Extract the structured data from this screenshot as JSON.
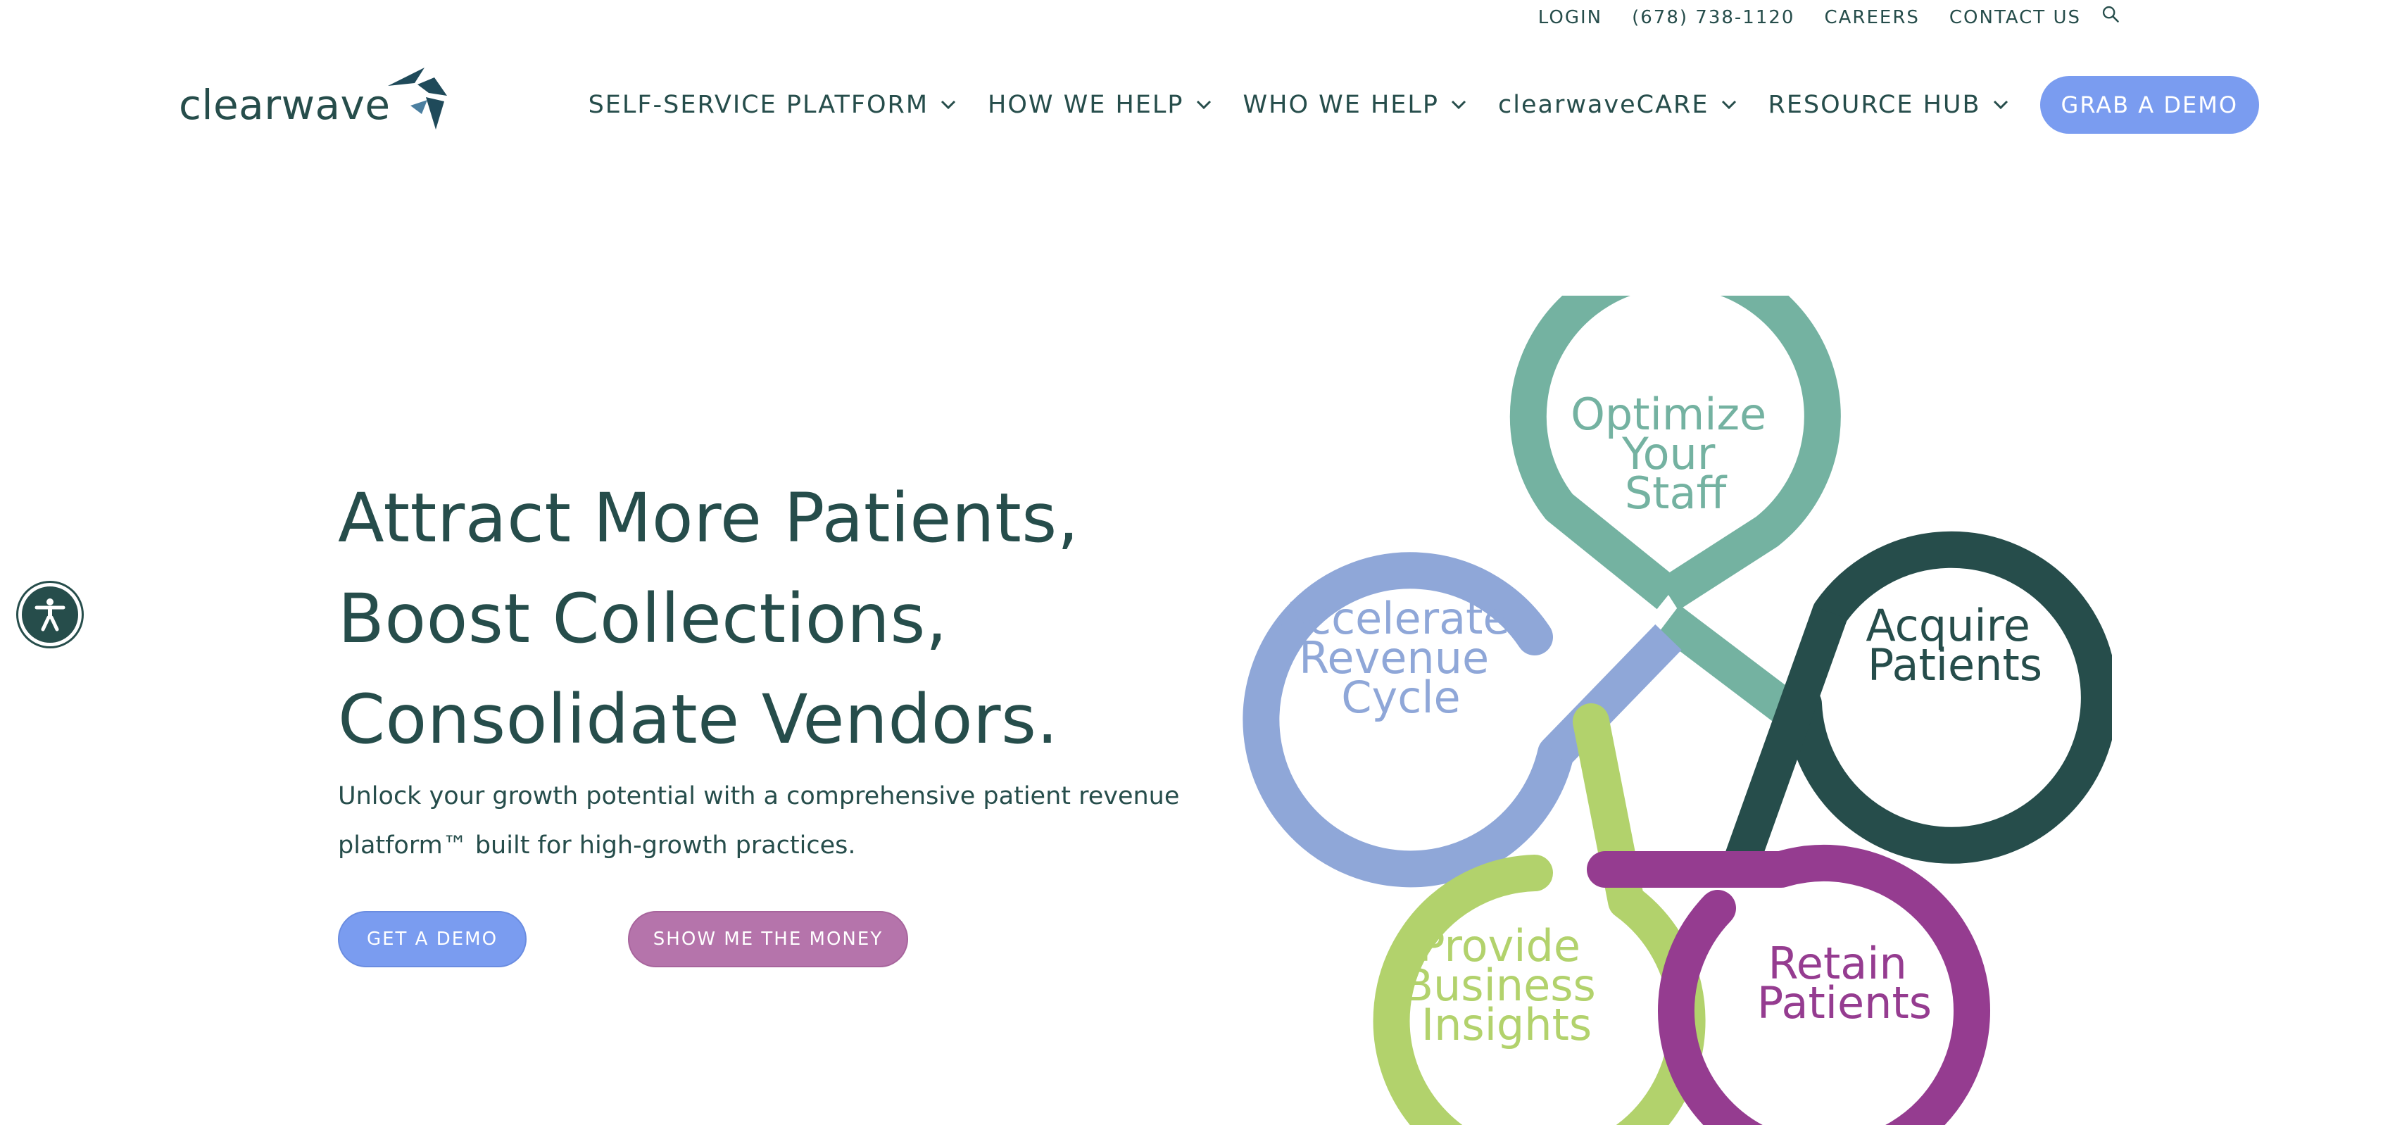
{
  "utility_nav": {
    "login": "LOGIN",
    "phone": "(678) 738-1120",
    "careers": "CAREERS",
    "contact": "CONTACT US"
  },
  "logo": {
    "text": "clearwave"
  },
  "main_nav": {
    "items": [
      {
        "label": "SELF-SERVICE PLATFORM"
      },
      {
        "label": "HOW WE HELP"
      },
      {
        "label": "WHO WE HELP"
      },
      {
        "label": "clearwaveCARE"
      },
      {
        "label": "RESOURCE HUB"
      }
    ],
    "cta": "GRAB A DEMO"
  },
  "hero": {
    "headline": [
      "Attract More Patients,",
      "Boost Collections,",
      "Consolidate Vendors."
    ],
    "subtext": "Unlock your growth potential with a comprehensive patient revenue platform™ built for high-growth practices.",
    "demo_button": "GET A DEMO",
    "money_button": "SHOW ME THE MONEY"
  },
  "diagram": {
    "petals": [
      {
        "lines": [
          "Optimize",
          "Your",
          "Staff"
        ],
        "color": "#74b2a1"
      },
      {
        "lines": [
          "Accelerate",
          "Revenue",
          "Cycle"
        ],
        "color": "#8fa7d8"
      },
      {
        "lines": [
          "Acquire",
          "Patients"
        ],
        "color": "#264d4b"
      },
      {
        "lines": [
          "Provide",
          "Business",
          "Insights"
        ],
        "color": "#b2d26c"
      },
      {
        "lines": [
          "Retain",
          "Patients"
        ],
        "color": "#953c90"
      }
    ]
  },
  "colors": {
    "brand_dark": "#264d4b",
    "accent_blue": "#7a9cf0",
    "accent_pink": "#b574ab"
  },
  "icons": {
    "search": "search-icon",
    "chevron": "chevron-down-icon",
    "accessibility": "accessibility-icon",
    "logo": "logo-mark-icon"
  }
}
